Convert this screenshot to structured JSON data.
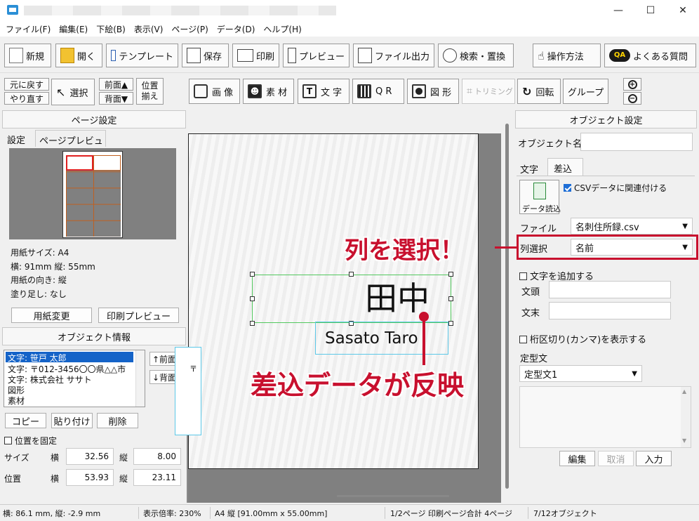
{
  "window": {
    "minimize": "—",
    "maximize": "☐",
    "close": "✕"
  },
  "menu": [
    "ファイル(F)",
    "編集(E)",
    "下絵(B)",
    "表示(V)",
    "ページ(P)",
    "データ(D)",
    "ヘルプ(H)"
  ],
  "toolbar": {
    "new": "新規",
    "open": "開く",
    "template": "テンプレート",
    "save": "保存",
    "print": "印刷",
    "preview": "プレビュー",
    "file_output": "ファイル出力",
    "search_replace": "検索・置換",
    "howto": "操作方法",
    "faq": "よくある質問"
  },
  "toolbar2": {
    "undo": "元に戻す",
    "redo": "やり直す",
    "select": "選択",
    "front": "前面▲",
    "back": "背面▼",
    "align_1": "位置",
    "align_2": "揃え",
    "image": "画 像",
    "material": "素 材",
    "text": "文 字",
    "qr": "Q R",
    "shape": "図 形",
    "trimming": "トリミング",
    "rotate": "回転",
    "group": "グループ",
    "zoom_in": "+",
    "zoom_out": "−"
  },
  "page_settings": {
    "header": "ページ設定",
    "tab_settings": "設定",
    "tab_preview": "ページプレビュー",
    "paper_size": "用紙サイズ: A4",
    "dimensions": "横: 91mm  縦: 55mm",
    "orientation": "用紙の向き: 縦",
    "bleed": "塗り足し: なし",
    "change_paper": "用紙変更",
    "print_preview": "印刷プレビュー"
  },
  "object_info": {
    "header": "オブジェクト情報",
    "items": [
      "文字: 笹戸 太郎",
      "文字: 〒012-3456〇〇県△△市",
      "文字: 株式会社 ササト",
      "図形",
      "素材"
    ],
    "front": "↑前面",
    "back": "↓背面",
    "copy": "コピー",
    "paste": "貼り付け",
    "delete": "削除",
    "fix_position": "位置を固定",
    "size_label": "サイズ",
    "pos_label": "位置",
    "w_label": "横",
    "h_label": "縦",
    "size_w": "32.56",
    "size_h": "8.00",
    "pos_x": "53.93",
    "pos_y": "23.11"
  },
  "canvas": {
    "name_text": "田中",
    "romaji_text": "Sasato Taro",
    "callout_top": "列を選択！",
    "callout_bottom": "差込データが反映",
    "accent": "#c8102e"
  },
  "object_settings": {
    "header": "オブジェクト設定",
    "name_label": "オブジェクト名",
    "name_value": "",
    "tab_text": "文字",
    "tab_merge": "差込",
    "data_load": "データ読込",
    "csv_link": "CSVデータに関連付ける",
    "file_label": "ファイル",
    "file_value": "名刺住所録.csv",
    "column_label": "列選択",
    "column_value": "名前",
    "add_text": "文字を追加する",
    "prefix_label": "文頭",
    "suffix_label": "文末",
    "comma": "桁区切り(カンマ)を表示する",
    "fixed_label": "定型文",
    "fixed_value": "定型文1",
    "edit": "編集",
    "cancel": "取消",
    "input": "入力"
  },
  "status": {
    "coords": "横: 86.1 mm, 縦: -2.9 mm",
    "zoom": "表示倍率: 230%",
    "paper": "A4 縦 [91.00mm x 55.00mm]",
    "pages": "1/2ページ 印刷ページ合計 4ページ",
    "objects": "7/12オブジェクト"
  }
}
